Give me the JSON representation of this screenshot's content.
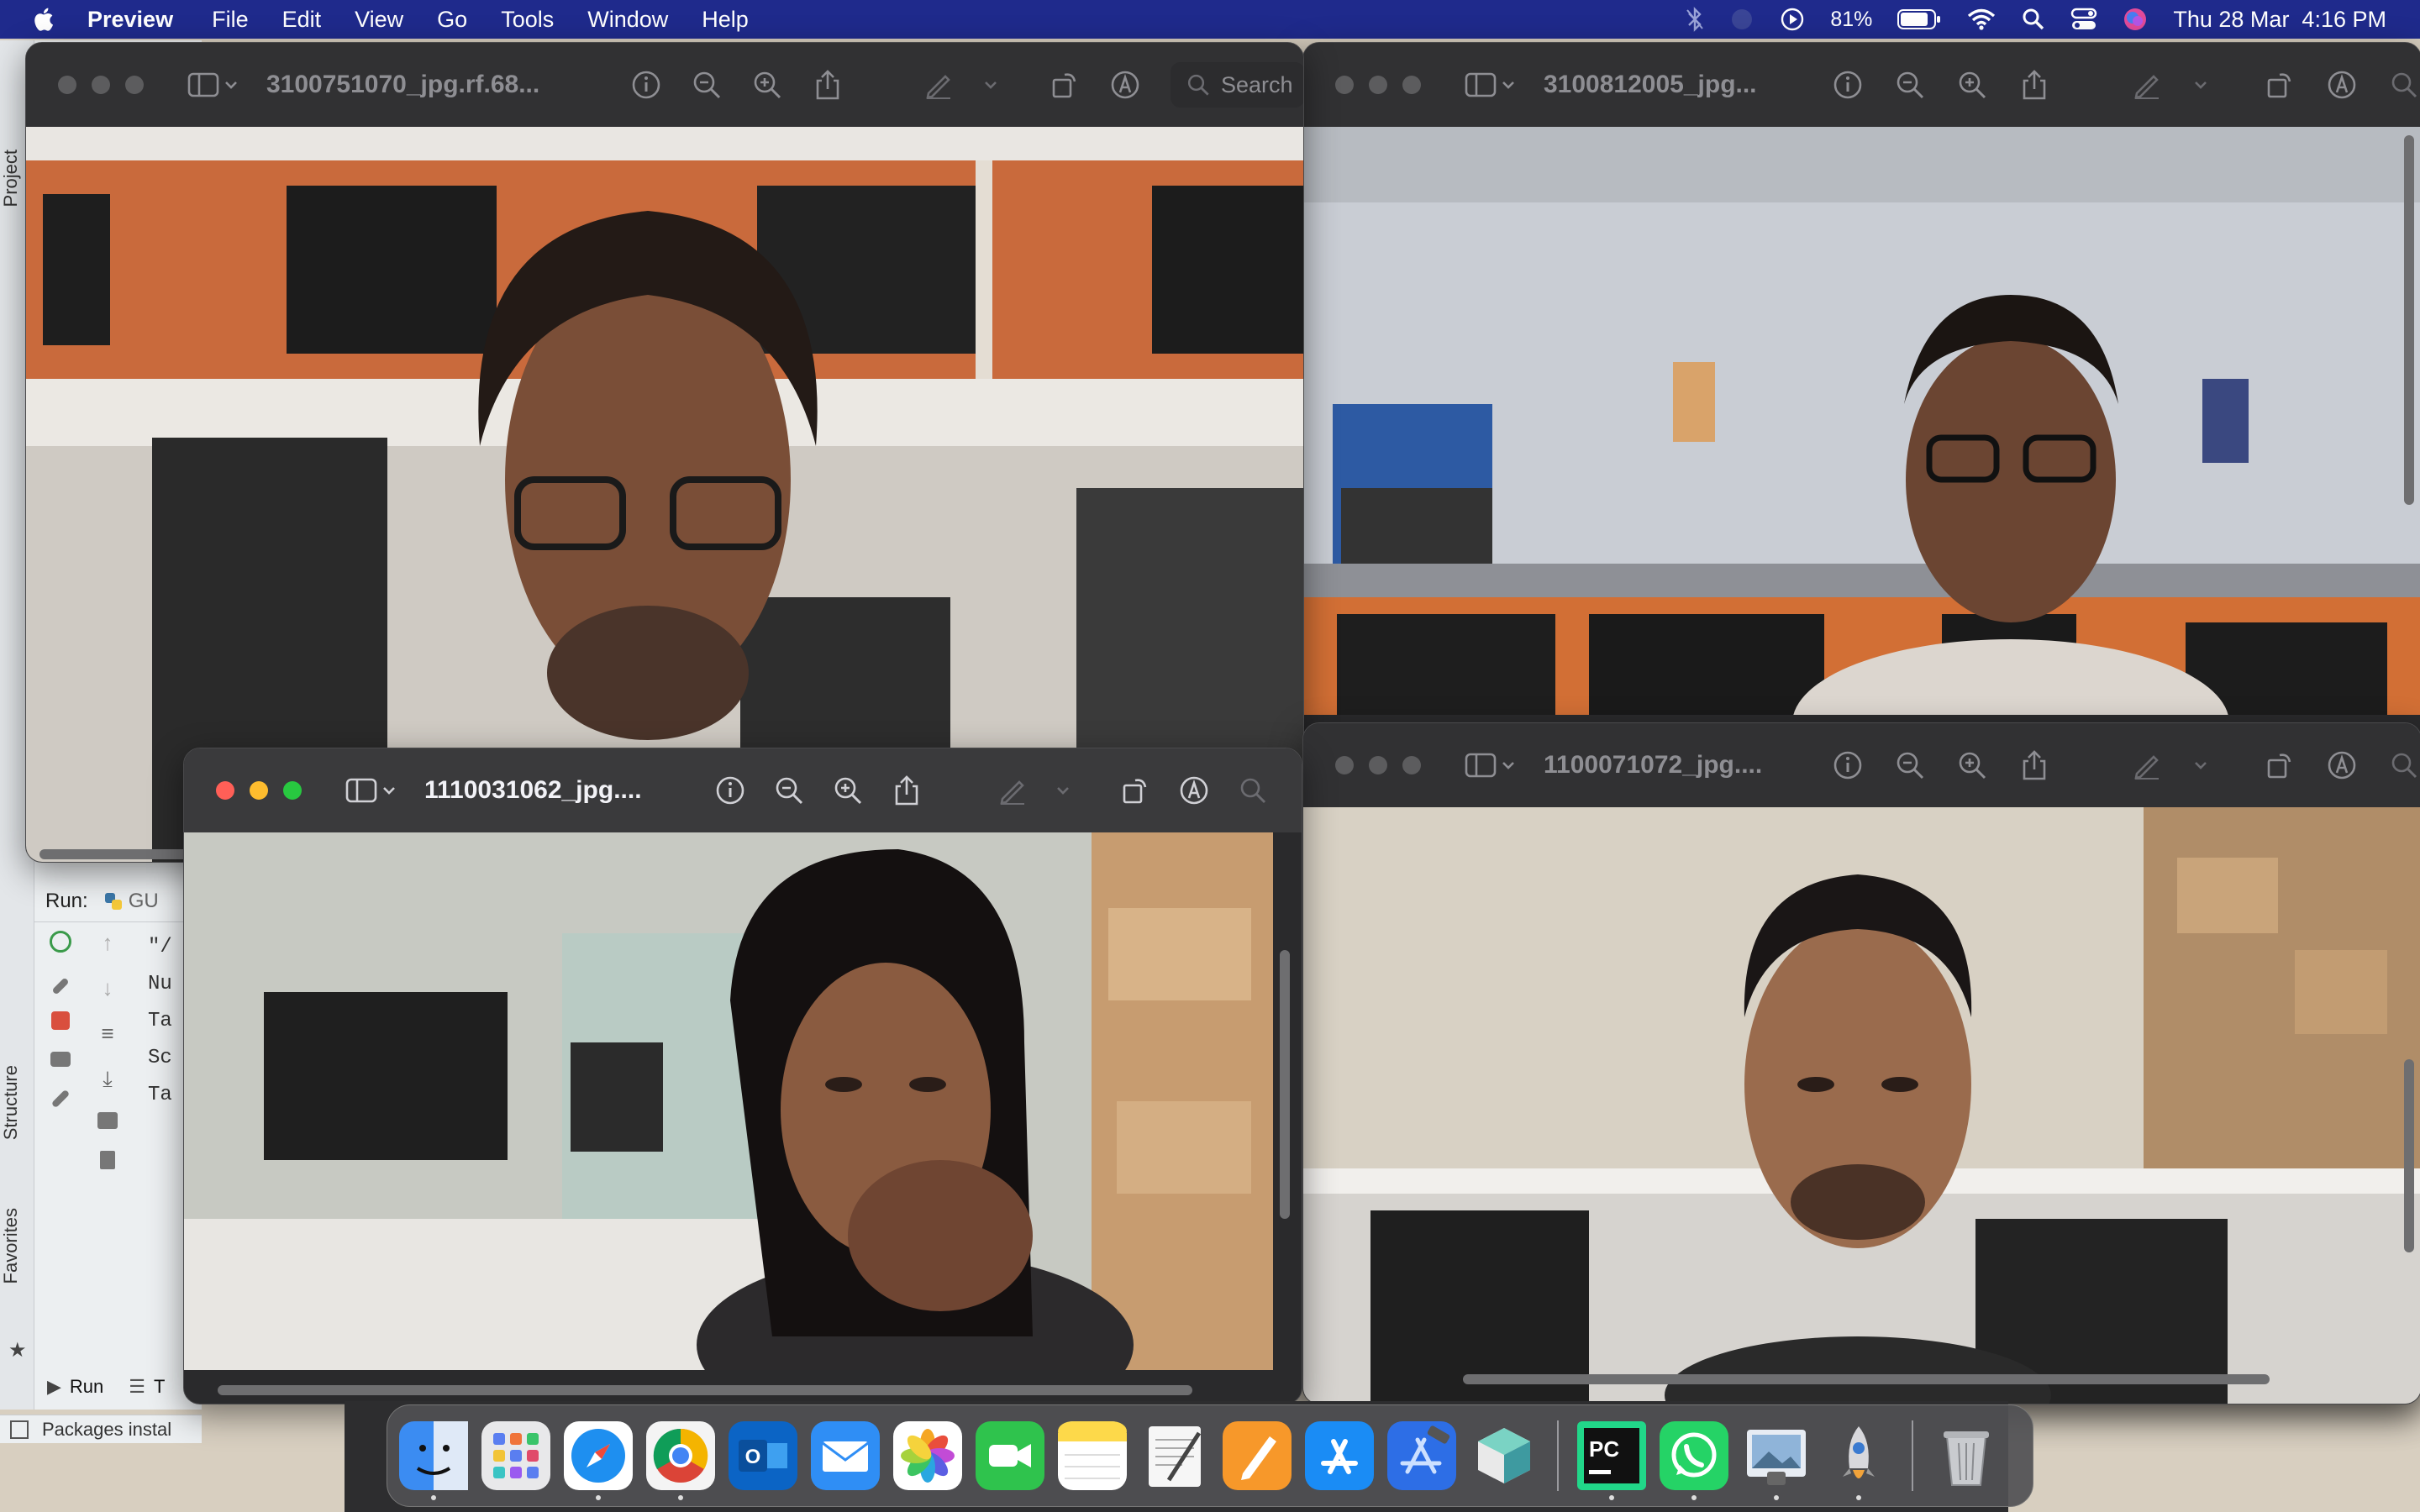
{
  "menubar": {
    "app_name": "Preview",
    "menus": [
      "File",
      "Edit",
      "View",
      "Go",
      "Tools",
      "Window",
      "Help"
    ],
    "battery": "81%",
    "clock": "Thu 28 Mar  4:16 PM"
  },
  "ide": {
    "project_label": "Project",
    "structure_label": "Structure",
    "favorites_label": "Favorites",
    "run_label": "Run:",
    "run_config": "GU",
    "console_lines": [
      "\"/",
      "Nu",
      "Ta",
      "Sc",
      "Ta"
    ],
    "run_tab": "Run",
    "todo_tab": "T",
    "status_text": "Packages instal"
  },
  "windows": {
    "top_left": {
      "title": "3100751070_jpg.rf.68...",
      "search_placeholder": "Search",
      "active": false
    },
    "top_right": {
      "title": "3100812005_jpg...",
      "active": false
    },
    "bottom_left": {
      "title": "1110031062_jpg....",
      "active": true
    },
    "bottom_right": {
      "title": "1100071072_jpg....",
      "active": false
    }
  },
  "dock": {
    "apps": [
      {
        "name": "Finder",
        "color": "#3b8cf2",
        "running": true
      },
      {
        "name": "Launchpad",
        "color": "#e8e8ea",
        "running": false
      },
      {
        "name": "Safari",
        "color": "#1e8ff0",
        "running": true
      },
      {
        "name": "Chrome",
        "color": "#f4f4f4",
        "running": true
      },
      {
        "name": "Outlook",
        "color": "#0b64c5",
        "running": false
      },
      {
        "name": "Mail",
        "color": "#2f8ef5",
        "running": false
      },
      {
        "name": "Photos",
        "color": "#ffffff",
        "running": false
      },
      {
        "name": "FaceTime",
        "color": "#2fc34d",
        "running": false
      },
      {
        "name": "Notes",
        "color": "#fdd94a",
        "running": false
      },
      {
        "name": "TextEdit",
        "color": "#f1f1f1",
        "running": false
      },
      {
        "name": "Pages",
        "color": "#f7982a",
        "running": false
      },
      {
        "name": "App Store",
        "color": "#1a8cf5",
        "running": false
      },
      {
        "name": "Xcode",
        "color": "#2d6ee6",
        "running": false
      },
      {
        "name": "Blender Cube",
        "color": "#58c4c0",
        "running": false
      },
      {
        "name": "PyCharm",
        "color": "#111111",
        "running": true
      },
      {
        "name": "WhatsApp",
        "color": "#25d366",
        "running": true
      },
      {
        "name": "Preview",
        "color": "#c8d4e6",
        "running": true
      },
      {
        "name": "Rocket",
        "color": "#3a3a3c",
        "running": true
      },
      {
        "name": "Trash",
        "color": "#a7a9ad",
        "running": false
      }
    ]
  }
}
